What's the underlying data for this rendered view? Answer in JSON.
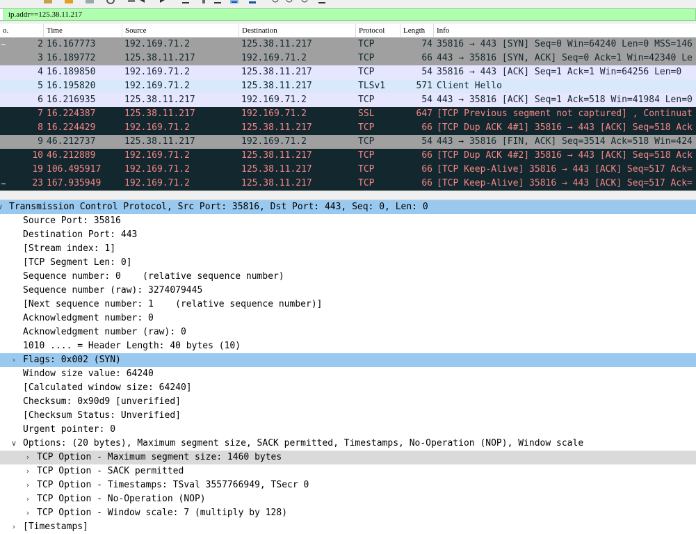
{
  "filter": {
    "value": "ip.addr==125.38.11.217"
  },
  "packet_list": {
    "columns": [
      "o.",
      "Time",
      "Source",
      "Destination",
      "Protocol",
      "Length",
      "Info"
    ],
    "rows": [
      {
        "no": "2",
        "time": "16.167773",
        "src": "192.169.71.2",
        "dst": "125.38.11.217",
        "proto": "TCP",
        "len": "74",
        "info": "35816 → 443 [SYN] Seq=0 Win=64240 Len=0 MSS=146",
        "style": "gray",
        "mark": true
      },
      {
        "no": "3",
        "time": "16.189772",
        "src": "125.38.11.217",
        "dst": "192.169.71.2",
        "proto": "TCP",
        "len": "66",
        "info": "443 → 35816 [SYN, ACK] Seq=0 Ack=1 Win=42340 Le",
        "style": "gray",
        "mark": false
      },
      {
        "no": "4",
        "time": "16.189850",
        "src": "192.169.71.2",
        "dst": "125.38.11.217",
        "proto": "TCP",
        "len": "54",
        "info": "35816 → 443 [ACK] Seq=1 Ack=1 Win=64256 Len=0",
        "style": "lav",
        "mark": false
      },
      {
        "no": "5",
        "time": "16.195820",
        "src": "192.169.71.2",
        "dst": "125.38.11.217",
        "proto": "TLSv1",
        "len": "571",
        "info": "Client Hello",
        "style": "blue",
        "mark": false
      },
      {
        "no": "6",
        "time": "16.216935",
        "src": "125.38.11.217",
        "dst": "192.169.71.2",
        "proto": "TCP",
        "len": "54",
        "info": "443 → 35816 [ACK] Seq=1 Ack=518 Win=41984 Len=0",
        "style": "lav",
        "mark": false
      },
      {
        "no": "7",
        "time": "16.224387",
        "src": "125.38.11.217",
        "dst": "192.169.71.2",
        "proto": "SSL",
        "len": "647",
        "info": "[TCP Previous segment not captured] , Continuat",
        "style": "black",
        "mark": false
      },
      {
        "no": "8",
        "time": "16.224429",
        "src": "192.169.71.2",
        "dst": "125.38.11.217",
        "proto": "TCP",
        "len": "66",
        "info": "[TCP Dup ACK 4#1] 35816 → 443 [ACK] Seq=518 Ack",
        "style": "black",
        "mark": false
      },
      {
        "no": "9",
        "time": "46.212737",
        "src": "125.38.11.217",
        "dst": "192.169.71.2",
        "proto": "TCP",
        "len": "54",
        "info": "443 → 35816 [FIN, ACK] Seq=3514 Ack=518 Win=424",
        "style": "gray",
        "mark": false
      },
      {
        "no": "10",
        "time": "46.212889",
        "src": "192.169.71.2",
        "dst": "125.38.11.217",
        "proto": "TCP",
        "len": "66",
        "info": "[TCP Dup ACK 4#2] 35816 → 443 [ACK] Seq=518 Ack",
        "style": "black",
        "mark": false
      },
      {
        "no": "19",
        "time": "106.495917",
        "src": "192.169.71.2",
        "dst": "125.38.11.217",
        "proto": "TCP",
        "len": "66",
        "info": "[TCP Keep-Alive] 35816 → 443 [ACK] Seq=517 Ack=",
        "style": "black",
        "mark": false
      },
      {
        "no": "23",
        "time": "167.935949",
        "src": "192.169.71.2",
        "dst": "125.38.11.217",
        "proto": "TCP",
        "len": "66",
        "info": "[TCP Keep-Alive] 35816 → 443 [ACK] Seq=517 Ack=",
        "style": "black",
        "mark": true
      }
    ]
  },
  "details": {
    "rows": [
      {
        "level": 0,
        "arrow": "chevron-down",
        "text": "Transmission Control Protocol, Src Port: 35816, Dst Port: 443, Seq: 0, Len: 0",
        "state": "selected"
      },
      {
        "level": 1,
        "arrow": "",
        "text": "Source Port: 35816",
        "state": ""
      },
      {
        "level": 1,
        "arrow": "",
        "text": "Destination Port: 443",
        "state": ""
      },
      {
        "level": 1,
        "arrow": "",
        "text": "[Stream index: 1]",
        "state": ""
      },
      {
        "level": 1,
        "arrow": "",
        "text": "[TCP Segment Len: 0]",
        "state": ""
      },
      {
        "level": 1,
        "arrow": "",
        "text": "Sequence number: 0    (relative sequence number)",
        "state": ""
      },
      {
        "level": 1,
        "arrow": "",
        "text": "Sequence number (raw): 3274079445",
        "state": ""
      },
      {
        "level": 1,
        "arrow": "",
        "text": "[Next sequence number: 1    (relative sequence number)]",
        "state": ""
      },
      {
        "level": 1,
        "arrow": "",
        "text": "Acknowledgment number: 0",
        "state": ""
      },
      {
        "level": 1,
        "arrow": "",
        "text": "Acknowledgment number (raw): 0",
        "state": ""
      },
      {
        "level": 1,
        "arrow": "",
        "text": "1010 .... = Header Length: 40 bytes (10)",
        "state": ""
      },
      {
        "level": 1,
        "arrow": "chevron-right",
        "text": "Flags: 0x002 (SYN)",
        "state": "selected"
      },
      {
        "level": 1,
        "arrow": "",
        "text": "Window size value: 64240",
        "state": ""
      },
      {
        "level": 1,
        "arrow": "",
        "text": "[Calculated window size: 64240]",
        "state": ""
      },
      {
        "level": 1,
        "arrow": "",
        "text": "Checksum: 0x90d9 [unverified]",
        "state": ""
      },
      {
        "level": 1,
        "arrow": "",
        "text": "[Checksum Status: Unverified]",
        "state": ""
      },
      {
        "level": 1,
        "arrow": "",
        "text": "Urgent pointer: 0",
        "state": ""
      },
      {
        "level": 1,
        "arrow": "chevron-down",
        "text": "Options: (20 bytes), Maximum segment size, SACK permitted, Timestamps, No-Operation (NOP), Window scale",
        "state": ""
      },
      {
        "level": 2,
        "arrow": "chevron-right",
        "text": "TCP Option - Maximum segment size: 1460 bytes",
        "state": "hover"
      },
      {
        "level": 2,
        "arrow": "chevron-right",
        "text": "TCP Option - SACK permitted",
        "state": ""
      },
      {
        "level": 2,
        "arrow": "chevron-right",
        "text": "TCP Option - Timestamps: TSval 3557766949, TSecr 0",
        "state": ""
      },
      {
        "level": 2,
        "arrow": "chevron-right",
        "text": "TCP Option - No-Operation (NOP)",
        "state": ""
      },
      {
        "level": 2,
        "arrow": "chevron-right",
        "text": "TCP Option - Window scale: 7 (multiply by 128)",
        "state": ""
      },
      {
        "level": 1,
        "arrow": "chevron-right",
        "text": "[Timestamps]",
        "state": ""
      }
    ]
  },
  "colors": {
    "row_gray": "#a0a0a0",
    "row_lavender": "#e7e6ff",
    "row_blue": "#dae8fc",
    "row_black": "#12272e",
    "row_black_text": "#f78787",
    "selected": "#99c9ef",
    "filter_bg": "#afffaf"
  }
}
